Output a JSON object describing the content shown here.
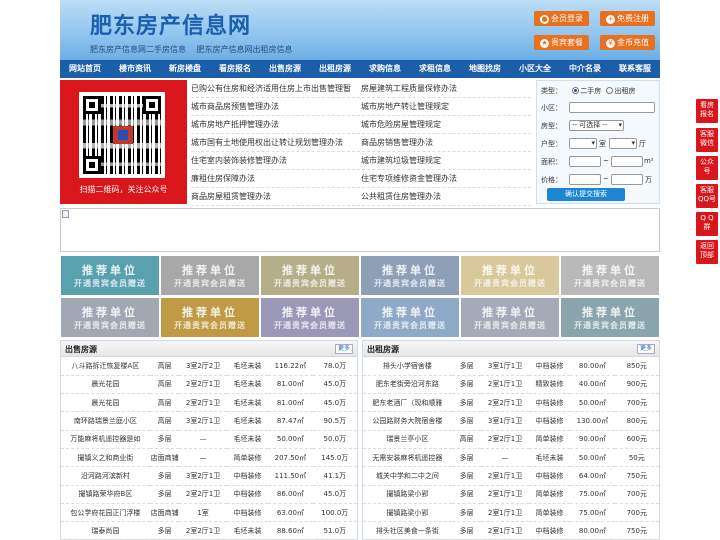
{
  "header": {
    "title": "肥东房产信息网",
    "subtitle_links": [
      "肥东房产信息网二手房信息",
      "肥东房产信息网出租房信息"
    ],
    "buttons": {
      "login": "会员登录",
      "register": "免费注册",
      "package": "贵宾套餐",
      "recharge": "金币充值"
    }
  },
  "nav": [
    "网站首页",
    "楼市资讯",
    "新房楼盘",
    "看房报名",
    "出售房源",
    "出租房源",
    "求购信息",
    "求租信息",
    "地图找房",
    "小区大全",
    "中介名录",
    "联系客服"
  ],
  "qr": {
    "caption": "扫描二维码，关注公众号"
  },
  "links": [
    [
      "已购公有住房和经济适用住房上市出售管理暂",
      "房屋建筑工程质量保修办法"
    ],
    [
      "城市商品房预售管理办法",
      "城市房地产转让管理规定"
    ],
    [
      "城市房地产抵押管理办法",
      "城市危险房屋管理规定"
    ],
    [
      "城市国有土地使用权出让转让规划管理办法",
      "商品房销售管理办法"
    ],
    [
      "住宅室内装饰装修管理办法",
      "城市建筑垃圾管理规定"
    ],
    [
      "廉租住房保障办法",
      "住宅专项维修资金管理办法"
    ],
    [
      "商品房屋租赁管理办法",
      "公共租赁住房管理办法"
    ]
  ],
  "search": {
    "type_label": "类型：",
    "type_options": [
      "二手房",
      "出租房"
    ],
    "community_label": "小区：",
    "kind_label": "房型：",
    "kind_select": "-- 可选择 --",
    "layout_label": "户型：",
    "room_unit": "室",
    "hall_unit": "厅",
    "area_label": "面积：",
    "area_unit": "m²",
    "price_label": "价格：",
    "price_unit": "万",
    "submit": "确认提交搜索"
  },
  "recommend": {
    "line1": "推荐单位",
    "line2": "开通贵宾会员赠送",
    "colors": [
      "#5aa1b0",
      "#a8a8a8",
      "#b5ae88",
      "#8ea0b8",
      "#d9c89a",
      "#b9b9b9",
      "#a1a8b4",
      "#c09a45",
      "#9c98b8",
      "#8fa9c8",
      "#a5aab9",
      "#8aa5ad"
    ]
  },
  "sale": {
    "title": "出售房源",
    "more": "更多",
    "rows": [
      [
        "八斗路拆迁恢复楼A区",
        "高层",
        "3室2厅2卫",
        "毛坯未装",
        "116.22㎡",
        "78.0万"
      ],
      [
        "晨光花园",
        "高层",
        "2室2厅1卫",
        "毛坯未装",
        "81.00㎡",
        "45.0万"
      ],
      [
        "晨光花园",
        "高层",
        "2室2厅1卫",
        "毛坯未装",
        "81.00㎡",
        "45.0万"
      ],
      [
        "南环路瑞景兰庭小区",
        "高层",
        "3室2厅1卫",
        "毛坯未装",
        "87.47㎡",
        "90.5万"
      ],
      [
        "万能麻将机遥控器是如",
        "多层",
        "—",
        "毛坯未装",
        "50.00㎡",
        "50.0万"
      ],
      [
        "撮镇义之和商业街",
        "店面商铺",
        "—",
        "简单装修",
        "207.50㎡",
        "145.0万"
      ],
      [
        "沿河路河滨新村",
        "多层",
        "3室2厅1卫",
        "中档装修",
        "111.50㎡",
        "41.1万"
      ],
      [
        "撮镇路荣华府B区",
        "多层",
        "2室2厅1卫",
        "中档装修",
        "86.00㎡",
        "45.0万"
      ],
      [
        "包公学府花园正门浮楼",
        "店面商铺",
        "1室",
        "中档装修",
        "63.00㎡",
        "100.0万"
      ],
      [
        "瑞泰尚园",
        "多层",
        "2室2厅1卫",
        "毛坯未装",
        "88.60㎡",
        "51.0万"
      ]
    ]
  },
  "rent": {
    "title": "出租房源",
    "more": "更多",
    "rows": [
      [
        "排头小学宿舍楼",
        "多层",
        "3室1厅1卫",
        "中档装修",
        "80.00㎡",
        "850元"
      ],
      [
        "肥东老街旁沿河东路",
        "多层",
        "2室1厅1卫",
        "精致装修",
        "40.00㎡",
        "900元"
      ],
      [
        "肥东老酒厂（现和顺雅",
        "多层",
        "2室2厅1卫",
        "中档装修",
        "50.00㎡",
        "700元"
      ],
      [
        "公园路财务大院宿舍楼",
        "多层",
        "3室1厅1卫",
        "中档装修",
        "130.00㎡",
        "800元"
      ],
      [
        "瑞景兰亭小区",
        "高层",
        "2室2厅1卫",
        "简单装修",
        "90.00㎡",
        "600元"
      ],
      [
        "无需安装麻将机遥控器",
        "多层",
        "—",
        "毛坯未装",
        "50.00㎡",
        "50元"
      ],
      [
        "城关中学和二中之间",
        "多层",
        "2室1厅1卫",
        "中档装修",
        "64.00㎡",
        "750元"
      ],
      [
        "撮镇路梁小郢",
        "多层",
        "2室1厅1卫",
        "简单装修",
        "75.00㎡",
        "700元"
      ],
      [
        "撮镇路梁小郢",
        "多层",
        "2室1厅1卫",
        "简单装修",
        "75.00㎡",
        "700元"
      ],
      [
        "排头社区美食一条街",
        "多层",
        "2室1厅1卫",
        "中档装修",
        "80.00㎡",
        "750元"
      ]
    ]
  },
  "side": [
    [
      "看房",
      "报名"
    ],
    [
      "客服",
      "微信"
    ],
    [
      "公众",
      "号"
    ],
    [
      "客服",
      "QQ号"
    ],
    [
      "Q Q",
      "群"
    ],
    [
      "返回",
      "顶部"
    ]
  ]
}
